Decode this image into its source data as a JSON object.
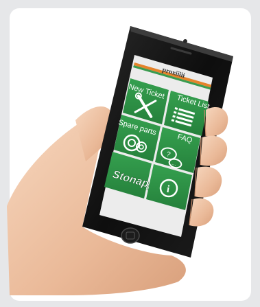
{
  "logo": {
    "text": "proxiiiii"
  },
  "tiles": [
    {
      "label": "New Ticket",
      "icon": "wrench-screwdriver-icon"
    },
    {
      "label": "Ticket List",
      "icon": "list-icon"
    },
    {
      "label": "Spare parts",
      "icon": "gears-icon"
    },
    {
      "label": "FAQ",
      "icon": "speech-bubbles-question-icon"
    },
    {
      "label": "Stonapp.",
      "icon": "stonapp-logo"
    },
    {
      "label": "",
      "icon": "info-icon"
    }
  ],
  "colors": {
    "background": "#e6e7e9",
    "card": "#ffffff",
    "tile_green": "#2d9245",
    "phone_body": "#141414",
    "screen_bg": "#ececec",
    "skin": "#f1c8a8"
  }
}
